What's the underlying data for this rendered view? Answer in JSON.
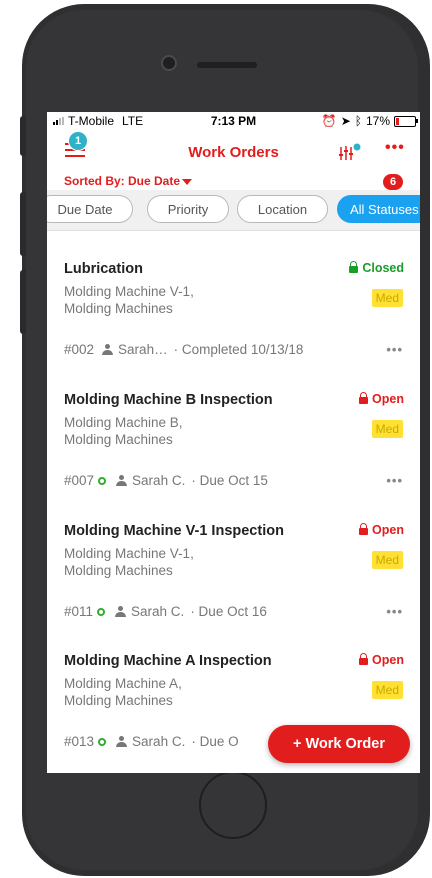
{
  "status_bar": {
    "carrier": "T-Mobile",
    "network": "LTE",
    "time": "7:13 PM",
    "battery": "17%",
    "battery_level": 0.17
  },
  "header": {
    "title": "Work Orders",
    "notification_count": "1"
  },
  "sort": {
    "label": "Sorted By: Due Date",
    "count": "6"
  },
  "filters": [
    "Due Date",
    "Priority",
    "Location",
    "All Statuses"
  ],
  "work_orders": [
    {
      "title": "Lubrication",
      "location_line1": "Molding Machine V-1,",
      "location_line2": "Molding Machines",
      "status": "Closed",
      "priority": "Med",
      "id": "#002",
      "assignee": "Sarah…",
      "due": "· Completed 10/13/18"
    },
    {
      "title": "Molding Machine B Inspection",
      "location_line1": "Molding Machine B,",
      "location_line2": "Molding Machines",
      "status": "Open",
      "priority": "Med",
      "id": "#007",
      "assignee": "Sarah C.",
      "due": "· Due Oct 15"
    },
    {
      "title": "Molding Machine V-1 Inspection",
      "location_line1": "Molding Machine V-1,",
      "location_line2": "Molding Machines",
      "status": "Open",
      "priority": "Med",
      "id": "#011",
      "assignee": "Sarah C.",
      "due": "· Due Oct 16"
    },
    {
      "title": "Molding Machine A Inspection",
      "location_line1": "Molding Machine A,",
      "location_line2": "Molding Machines",
      "status": "Open",
      "priority": "Med",
      "id": "#013",
      "assignee": "Sarah C.",
      "due": "· Due O"
    }
  ],
  "fab": {
    "label": "+ Work Order"
  },
  "colors": {
    "accent": "#e21d1d",
    "active_chip": "#1aa2f0",
    "closed": "#1a9e2a",
    "priority_bg": "#ffe033",
    "badge": "#2fb2c8"
  }
}
